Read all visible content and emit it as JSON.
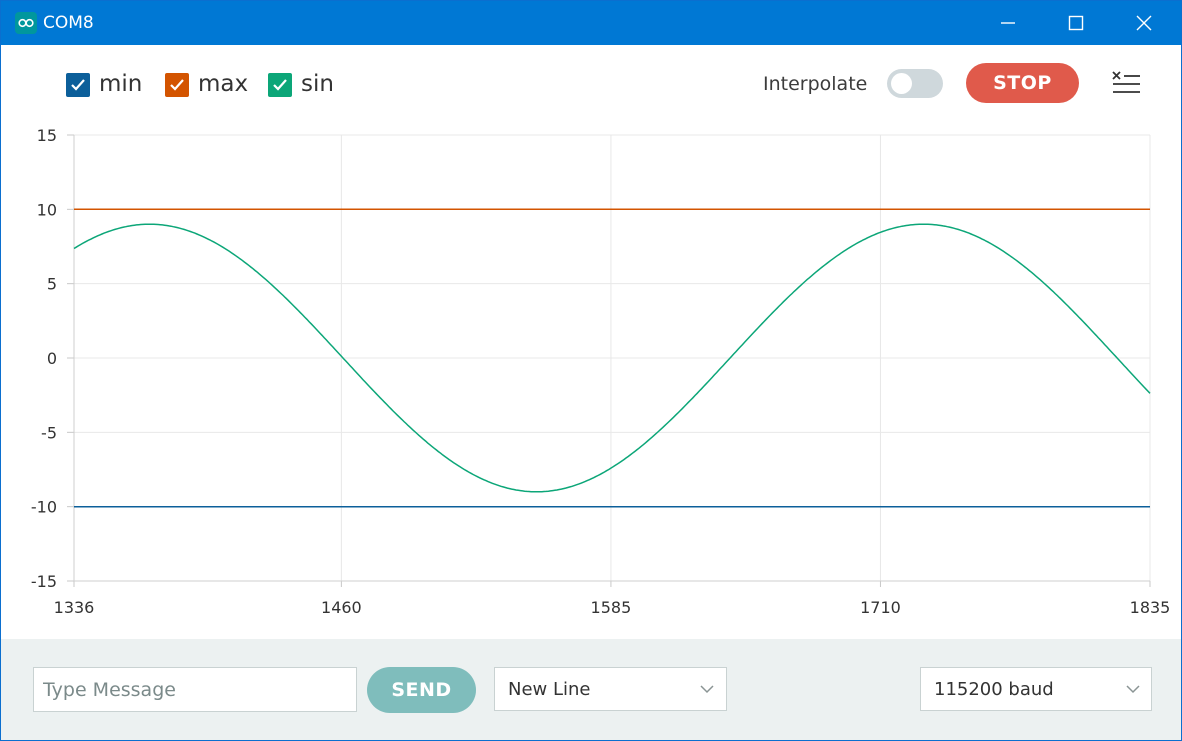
{
  "window": {
    "title": "COM8",
    "icon": "arduino-logo-icon",
    "controls": [
      "minimize-icon",
      "maximize-icon",
      "close-icon"
    ]
  },
  "toolbar": {
    "series_toggles": [
      {
        "label": "min",
        "checked": true,
        "color": "#0c5f9a"
      },
      {
        "label": "max",
        "checked": true,
        "color": "#d35400"
      },
      {
        "label": "sin",
        "checked": true,
        "color": "#0ca678"
      }
    ],
    "interpolate_label": "Interpolate",
    "interpolate_on": false,
    "stop_label": "STOP",
    "clear_icon": "clear-list-icon"
  },
  "chart_data": {
    "type": "line",
    "x_ticks": [
      "1336",
      "1460",
      "1585",
      "1710",
      "1835"
    ],
    "y_ticks": [
      "15",
      "10",
      "5",
      "0",
      "-5",
      "-10",
      "-15"
    ],
    "xlim": [
      1336,
      1835
    ],
    "ylim": [
      -15,
      15
    ],
    "grid": true,
    "series": [
      {
        "name": "min",
        "color": "#0c5f9a",
        "x": [
          1336,
          1835
        ],
        "y": [
          -10,
          -10
        ]
      },
      {
        "name": "max",
        "color": "#d35400",
        "x": [
          1336,
          1835
        ],
        "y": [
          10,
          10
        ]
      },
      {
        "name": "sin",
        "color": "#0ca678",
        "amplitude": 9,
        "x": [
          1336,
          1350,
          1371,
          1400,
          1430,
          1460,
          1490,
          1520,
          1551,
          1580,
          1610,
          1640,
          1670,
          1700,
          1730,
          1760,
          1790,
          1820,
          1835
        ],
        "y": [
          7.4,
          8.6,
          9.0,
          7.9,
          4.8,
          0.6,
          -3.8,
          -7.4,
          -9.0,
          -7.7,
          -4.4,
          0.2,
          4.4,
          7.7,
          9.0,
          7.8,
          4.6,
          0.4,
          -2.2
        ]
      }
    ]
  },
  "footer": {
    "message_placeholder": "Type Message",
    "message_value": "",
    "send_label": "SEND",
    "line_ending": "New Line",
    "baud_rate": "115200 baud"
  }
}
